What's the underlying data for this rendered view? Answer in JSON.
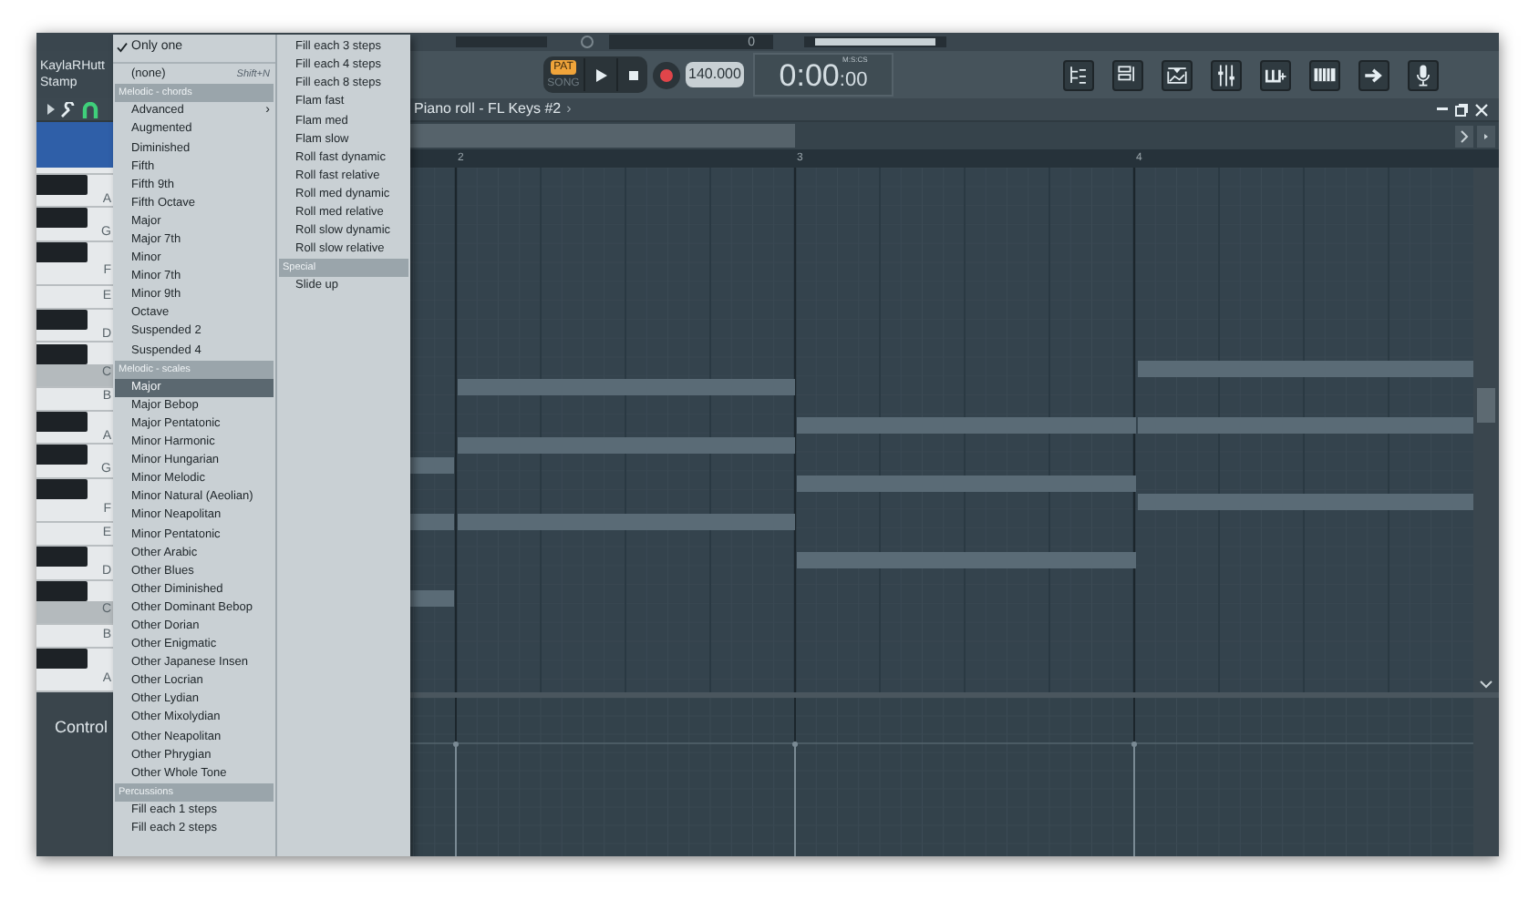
{
  "top_strip": {
    "reading": "0"
  },
  "account": {
    "name": "KaylaRHutt",
    "tool": "Stamp"
  },
  "transport": {
    "modes": [
      {
        "label": "PAT",
        "selected": true
      },
      {
        "label": "SONG",
        "selected": false
      }
    ],
    "tempo": "140.000",
    "time": "0:00",
    "time_fraction": ":00",
    "time_unit": "M:S:CS"
  },
  "window": {
    "title": "Piano roll - FL Keys #2",
    "title_arrow": "›"
  },
  "ruler": [
    "2",
    "3",
    "4"
  ],
  "piano_keys": [
    {
      "label": "A",
      "black_above": true,
      "highlighted": false
    },
    {
      "label": "G",
      "black_above": true,
      "highlighted": false
    },
    {
      "label": "F",
      "black_above": true,
      "highlighted": false
    },
    {
      "label": "E",
      "black_above": false,
      "highlighted": false
    },
    {
      "label": "D",
      "black_above": true,
      "highlighted": false
    },
    {
      "label": "C",
      "black_above": true,
      "highlighted": true
    },
    {
      "label": "B",
      "black_above": false,
      "highlighted": false
    },
    {
      "label": "A",
      "black_above": true,
      "highlighted": false
    },
    {
      "label": "G",
      "black_above": true,
      "highlighted": false
    },
    {
      "label": "F",
      "black_above": true,
      "highlighted": false
    },
    {
      "label": "E",
      "black_above": false,
      "highlighted": false
    },
    {
      "label": "D",
      "black_above": true,
      "highlighted": false
    },
    {
      "label": "C",
      "black_above": true,
      "highlighted": true
    },
    {
      "label": "B",
      "black_above": false,
      "highlighted": false
    },
    {
      "label": "A",
      "black_above": true,
      "highlighted": false
    }
  ],
  "event_panel": {
    "label": "Control"
  },
  "menu": {
    "columns": [
      [
        {
          "kind": "check",
          "label": "Only one",
          "checked": true
        },
        {
          "kind": "separator"
        },
        {
          "kind": "item",
          "label": "(none)",
          "shortcut": "Shift+N",
          "selected": false
        },
        {
          "kind": "header",
          "label": "Melodic - chords"
        },
        {
          "kind": "submenu",
          "label": "Advanced",
          "arrow": "›",
          "selected": false
        },
        {
          "kind": "item",
          "label": "Augmented",
          "selected": false
        },
        {
          "kind": "item",
          "label": "Diminished",
          "selected": false
        },
        {
          "kind": "item",
          "label": "Fifth",
          "selected": false
        },
        {
          "kind": "item",
          "label": "Fifth 9th",
          "selected": false
        },
        {
          "kind": "item",
          "label": "Fifth Octave",
          "selected": false
        },
        {
          "kind": "item",
          "label": "Major",
          "selected": false
        },
        {
          "kind": "item",
          "label": "Major 7th",
          "selected": false
        },
        {
          "kind": "item",
          "label": "Minor",
          "selected": false
        },
        {
          "kind": "item",
          "label": "Minor 7th",
          "selected": false
        },
        {
          "kind": "item",
          "label": "Minor 9th",
          "selected": false
        },
        {
          "kind": "item",
          "label": "Octave",
          "selected": false
        },
        {
          "kind": "item",
          "label": "Suspended 2",
          "selected": false
        },
        {
          "kind": "item",
          "label": "Suspended 4",
          "selected": false
        },
        {
          "kind": "header",
          "label": "Melodic - scales"
        },
        {
          "kind": "item",
          "label": "Major",
          "selected": true
        },
        {
          "kind": "item",
          "label": "Major Bebop",
          "selected": false
        },
        {
          "kind": "item",
          "label": "Major Pentatonic",
          "selected": false
        },
        {
          "kind": "item",
          "label": "Minor Harmonic",
          "selected": false
        },
        {
          "kind": "item",
          "label": "Minor Hungarian",
          "selected": false
        },
        {
          "kind": "item",
          "label": "Minor Melodic",
          "selected": false
        },
        {
          "kind": "item",
          "label": "Minor Natural (Aeolian)",
          "selected": false
        },
        {
          "kind": "item",
          "label": "Minor Neapolitan",
          "selected": false
        },
        {
          "kind": "item",
          "label": "Minor Pentatonic",
          "selected": false
        },
        {
          "kind": "item",
          "label": "Other Arabic",
          "selected": false
        },
        {
          "kind": "item",
          "label": "Other Blues",
          "selected": false
        },
        {
          "kind": "item",
          "label": "Other Diminished",
          "selected": false
        },
        {
          "kind": "item",
          "label": "Other Dominant Bebop",
          "selected": false
        },
        {
          "kind": "item",
          "label": "Other Dorian",
          "selected": false
        },
        {
          "kind": "item",
          "label": "Other Enigmatic",
          "selected": false
        },
        {
          "kind": "item",
          "label": "Other Japanese Insen",
          "selected": false
        },
        {
          "kind": "item",
          "label": "Other Locrian",
          "selected": false
        },
        {
          "kind": "item",
          "label": "Other Lydian",
          "selected": false
        },
        {
          "kind": "item",
          "label": "Other Mixolydian",
          "selected": false
        },
        {
          "kind": "item",
          "label": "Other Neapolitan",
          "selected": false
        },
        {
          "kind": "item",
          "label": "Other Phrygian",
          "selected": false
        },
        {
          "kind": "item",
          "label": "Other Whole Tone",
          "selected": false
        },
        {
          "kind": "header",
          "label": "Percussions"
        },
        {
          "kind": "item",
          "label": "Fill each 1 steps",
          "selected": false
        },
        {
          "kind": "item",
          "label": "Fill each 2 steps",
          "selected": false
        }
      ],
      [
        {
          "kind": "item",
          "label": "Fill each 3 steps",
          "selected": false
        },
        {
          "kind": "item",
          "label": "Fill each 4 steps",
          "selected": false
        },
        {
          "kind": "item",
          "label": "Fill each 8 steps",
          "selected": false
        },
        {
          "kind": "item",
          "label": "Flam fast",
          "selected": false
        },
        {
          "kind": "item",
          "label": "Flam med",
          "selected": false
        },
        {
          "kind": "item",
          "label": "Flam slow",
          "selected": false
        },
        {
          "kind": "item",
          "label": "Roll fast dynamic",
          "selected": false
        },
        {
          "kind": "item",
          "label": "Roll fast relative",
          "selected": false
        },
        {
          "kind": "item",
          "label": "Roll med dynamic",
          "selected": false
        },
        {
          "kind": "item",
          "label": "Roll med relative",
          "selected": false
        },
        {
          "kind": "item",
          "label": "Roll slow dynamic",
          "selected": false
        },
        {
          "kind": "item",
          "label": "Roll slow relative",
          "selected": false
        },
        {
          "kind": "header",
          "label": "Special"
        },
        {
          "kind": "item",
          "label": "Slide up",
          "selected": false
        }
      ]
    ]
  }
}
